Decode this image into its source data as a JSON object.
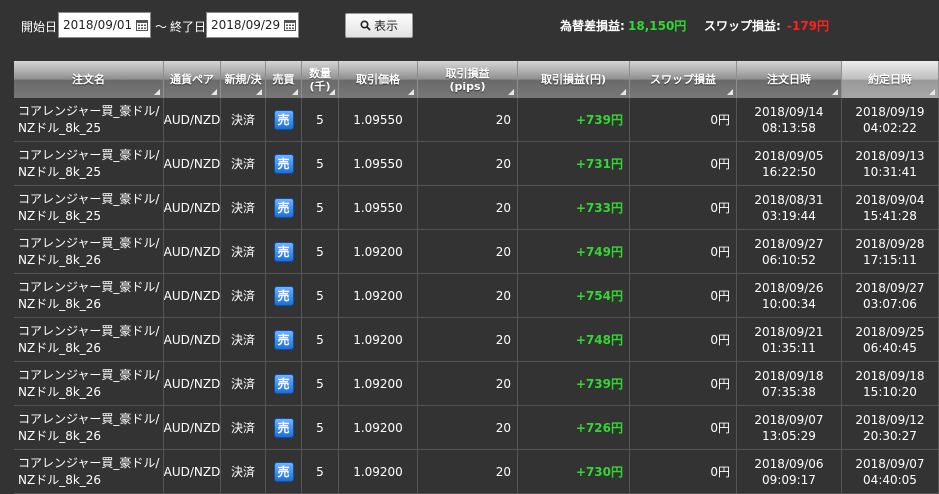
{
  "toolbar": {
    "start_label": "開始日",
    "start_date": "2018/09/01",
    "tilde": "～",
    "end_label": "終了日",
    "end_date": "2018/09/29",
    "show_label": "表示",
    "fx_pl_label": "為替差損益:",
    "fx_pl_value": "18,150円",
    "swap_pl_label": "スワップ損益:",
    "swap_pl_value": "-179円",
    "colors": {
      "profit": "#33d633",
      "loss": "#ff2020",
      "sell_badge": "#1e6ed8"
    }
  },
  "table": {
    "headers": {
      "name": "注文名",
      "pair": "通貨ペア",
      "type": "新規/決",
      "side": "売買",
      "qty_line1": "数量",
      "qty_line2": "(千)",
      "price": "取引価格",
      "pips_line1": "取引損益",
      "pips_line2": "(pips)",
      "pl_yen": "取引損益(円)",
      "swap": "スワップ損益",
      "order_dt": "注文日時",
      "settle_dt": "約定日時"
    },
    "rows": [
      {
        "name": "コアレンジャー買_豪ドル/NZドル_8k_25",
        "pair": "AUD/NZD",
        "type": "決済",
        "side": "売",
        "qty": "5",
        "price": "1.09550",
        "pips": "20",
        "pl": "+739円",
        "swap": "0円",
        "order_date": "2018/09/14",
        "order_time": "08:13:58",
        "settle_date": "2018/09/19",
        "settle_time": "04:02:22"
      },
      {
        "name": "コアレンジャー買_豪ドル/NZドル_8k_25",
        "pair": "AUD/NZD",
        "type": "決済",
        "side": "売",
        "qty": "5",
        "price": "1.09550",
        "pips": "20",
        "pl": "+731円",
        "swap": "0円",
        "order_date": "2018/09/05",
        "order_time": "16:22:50",
        "settle_date": "2018/09/13",
        "settle_time": "10:31:41"
      },
      {
        "name": "コアレンジャー買_豪ドル/NZドル_8k_25",
        "pair": "AUD/NZD",
        "type": "決済",
        "side": "売",
        "qty": "5",
        "price": "1.09550",
        "pips": "20",
        "pl": "+733円",
        "swap": "0円",
        "order_date": "2018/08/31",
        "order_time": "03:19:44",
        "settle_date": "2018/09/04",
        "settle_time": "15:41:28"
      },
      {
        "name": "コアレンジャー買_豪ドル/NZドル_8k_26",
        "pair": "AUD/NZD",
        "type": "決済",
        "side": "売",
        "qty": "5",
        "price": "1.09200",
        "pips": "20",
        "pl": "+749円",
        "swap": "0円",
        "order_date": "2018/09/27",
        "order_time": "06:10:52",
        "settle_date": "2018/09/28",
        "settle_time": "17:15:11"
      },
      {
        "name": "コアレンジャー買_豪ドル/NZドル_8k_26",
        "pair": "AUD/NZD",
        "type": "決済",
        "side": "売",
        "qty": "5",
        "price": "1.09200",
        "pips": "20",
        "pl": "+754円",
        "swap": "0円",
        "order_date": "2018/09/26",
        "order_time": "10:00:34",
        "settle_date": "2018/09/27",
        "settle_time": "03:07:06"
      },
      {
        "name": "コアレンジャー買_豪ドル/NZドル_8k_26",
        "pair": "AUD/NZD",
        "type": "決済",
        "side": "売",
        "qty": "5",
        "price": "1.09200",
        "pips": "20",
        "pl": "+748円",
        "swap": "0円",
        "order_date": "2018/09/21",
        "order_time": "01:35:11",
        "settle_date": "2018/09/25",
        "settle_time": "06:40:45"
      },
      {
        "name": "コアレンジャー買_豪ドル/NZドル_8k_26",
        "pair": "AUD/NZD",
        "type": "決済",
        "side": "売",
        "qty": "5",
        "price": "1.09200",
        "pips": "20",
        "pl": "+739円",
        "swap": "0円",
        "order_date": "2018/09/18",
        "order_time": "07:35:38",
        "settle_date": "2018/09/18",
        "settle_time": "15:10:20"
      },
      {
        "name": "コアレンジャー買_豪ドル/NZドル_8k_26",
        "pair": "AUD/NZD",
        "type": "決済",
        "side": "売",
        "qty": "5",
        "price": "1.09200",
        "pips": "20",
        "pl": "+726円",
        "swap": "0円",
        "order_date": "2018/09/07",
        "order_time": "13:05:29",
        "settle_date": "2018/09/12",
        "settle_time": "20:30:27"
      },
      {
        "name": "コアレンジャー買_豪ドル/NZドル_8k_26",
        "pair": "AUD/NZD",
        "type": "決済",
        "side": "売",
        "qty": "5",
        "price": "1.09200",
        "pips": "20",
        "pl": "+730円",
        "swap": "0円",
        "order_date": "2018/09/06",
        "order_time": "09:09:17",
        "settle_date": "2018/09/07",
        "settle_time": "04:40:05"
      }
    ]
  }
}
